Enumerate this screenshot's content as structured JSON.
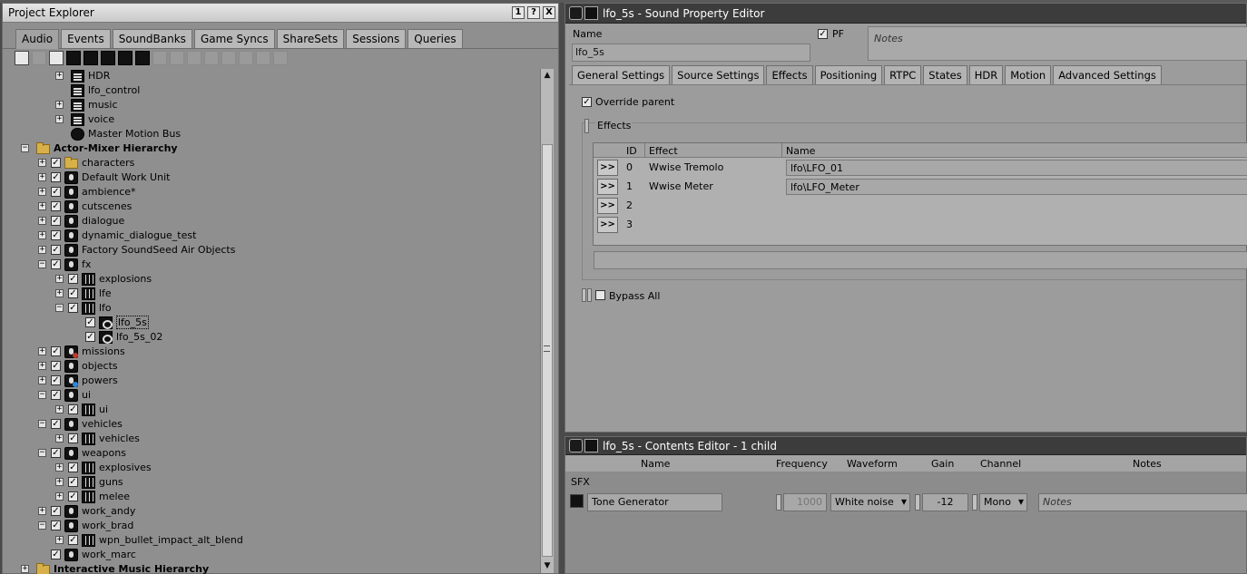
{
  "project_explorer": {
    "title": "Project Explorer",
    "title_buttons": [
      "1",
      "?",
      "X"
    ],
    "tabs": [
      "Audio",
      "Events",
      "SoundBanks",
      "Game Syncs",
      "ShareSets",
      "Sessions",
      "Queries"
    ],
    "active_tab": "Audio",
    "tree": [
      {
        "label": "HDR",
        "indent": 2,
        "icon": "bus",
        "exp": "+"
      },
      {
        "label": "lfo_control",
        "indent": 2,
        "icon": "bus",
        "exp": ""
      },
      {
        "label": "music",
        "indent": 2,
        "icon": "bus",
        "exp": "+"
      },
      {
        "label": "voice",
        "indent": 2,
        "icon": "bus",
        "exp": "+"
      },
      {
        "label": "Master Motion Bus",
        "indent": 2,
        "icon": "motion",
        "exp": ""
      },
      {
        "label": "Actor-Mixer Hierarchy",
        "indent": 0,
        "icon": "folder",
        "exp": "-",
        "bold": true,
        "check": false
      },
      {
        "label": "characters",
        "indent": 1,
        "icon": "folder",
        "exp": "+",
        "check": true
      },
      {
        "label": "Default Work Unit",
        "indent": 1,
        "icon": "wu",
        "exp": "+",
        "check": true
      },
      {
        "label": "ambience*",
        "indent": 1,
        "icon": "wu",
        "exp": "+",
        "check": true
      },
      {
        "label": "cutscenes",
        "indent": 1,
        "icon": "wu",
        "exp": "+",
        "check": true
      },
      {
        "label": "dialogue",
        "indent": 1,
        "icon": "wu",
        "exp": "+",
        "check": true
      },
      {
        "label": "dynamic_dialogue_test",
        "indent": 1,
        "icon": "wu",
        "exp": "+",
        "check": true
      },
      {
        "label": "Factory SoundSeed Air Objects",
        "indent": 1,
        "icon": "wu",
        "exp": "+",
        "check": true
      },
      {
        "label": "fx",
        "indent": 1,
        "icon": "wu",
        "exp": "-",
        "check": true
      },
      {
        "label": "explosions",
        "indent": 2,
        "icon": "mix",
        "exp": "+",
        "check": true
      },
      {
        "label": "lfe",
        "indent": 2,
        "icon": "mix",
        "exp": "+",
        "check": true
      },
      {
        "label": "lfo",
        "indent": 2,
        "icon": "mix",
        "exp": "-",
        "check": true
      },
      {
        "label": "lfo_5s",
        "indent": 3,
        "icon": "snd",
        "exp": "",
        "check": true,
        "selected": true
      },
      {
        "label": "lfo_5s_02",
        "indent": 3,
        "icon": "snd",
        "exp": "",
        "check": true
      },
      {
        "label": "missions",
        "indent": 1,
        "icon": "wu",
        "exp": "+",
        "check": true,
        "badge": "#c0392b"
      },
      {
        "label": "objects",
        "indent": 1,
        "icon": "wu",
        "exp": "+",
        "check": true
      },
      {
        "label": "powers",
        "indent": 1,
        "icon": "wu",
        "exp": "+",
        "check": true,
        "badge": "#2e86de"
      },
      {
        "label": "ui",
        "indent": 1,
        "icon": "wu",
        "exp": "-",
        "check": true
      },
      {
        "label": "ui",
        "indent": 2,
        "icon": "mix",
        "exp": "+",
        "check": true
      },
      {
        "label": "vehicles",
        "indent": 1,
        "icon": "wu",
        "exp": "-",
        "check": true
      },
      {
        "label": "vehicles",
        "indent": 2,
        "icon": "mix",
        "exp": "+",
        "check": true
      },
      {
        "label": "weapons",
        "indent": 1,
        "icon": "wu",
        "exp": "-",
        "check": true
      },
      {
        "label": "explosives",
        "indent": 2,
        "icon": "mix",
        "exp": "+",
        "check": true
      },
      {
        "label": "guns",
        "indent": 2,
        "icon": "mix",
        "exp": "+",
        "check": true
      },
      {
        "label": "melee",
        "indent": 2,
        "icon": "mix",
        "exp": "+",
        "check": true
      },
      {
        "label": "work_andy",
        "indent": 1,
        "icon": "wu",
        "exp": "+",
        "check": true
      },
      {
        "label": "work_brad",
        "indent": 1,
        "icon": "wu",
        "exp": "-",
        "check": true
      },
      {
        "label": "wpn_bullet_impact_alt_blend",
        "indent": 2,
        "icon": "blend",
        "exp": "+",
        "check": true
      },
      {
        "label": "work_marc",
        "indent": 1,
        "icon": "wu",
        "exp": "",
        "check": true
      },
      {
        "label": "Interactive Music Hierarchy",
        "indent": 0,
        "icon": "folder",
        "exp": "+",
        "bold": true,
        "check": false
      }
    ]
  },
  "property_editor": {
    "title": "lfo_5s - Sound Property Editor",
    "name_label": "Name",
    "name_value": "lfo_5s",
    "pf_label": "PF",
    "notes_placeholder": "Notes",
    "tabs": [
      "General Settings",
      "Source Settings",
      "Effects",
      "Positioning",
      "RTPC",
      "States",
      "HDR",
      "Motion",
      "Advanced Settings"
    ],
    "active_tab": "Effects",
    "override_parent_label": "Override parent",
    "effects_group_label": "Effects",
    "columns": {
      "id": "ID",
      "effect": "Effect",
      "name": "Name"
    },
    "effects": [
      {
        "button": ">>",
        "id": "0",
        "effect": "Wwise Tremolo",
        "name": "lfo\\LFO_01"
      },
      {
        "button": ">>",
        "id": "1",
        "effect": "Wwise Meter",
        "name": "lfo\\LFO_Meter"
      },
      {
        "button": ">>",
        "id": "2",
        "effect": "",
        "name": ""
      },
      {
        "button": ">>",
        "id": "3",
        "effect": "",
        "name": ""
      }
    ],
    "bypass_all_label": "Bypass All"
  },
  "contents_editor": {
    "title": "lfo_5s - Contents Editor - 1 child",
    "columns": {
      "name": "Name",
      "frequency": "Frequency",
      "waveform": "Waveform",
      "gain": "Gain",
      "channel": "Channel",
      "notes": "Notes"
    },
    "section": "SFX",
    "row": {
      "name": "Tone Generator",
      "frequency": "1000",
      "waveform": "White noise",
      "gain": "-12",
      "channel": "Mono",
      "notes_placeholder": "Notes"
    }
  },
  "colors": {
    "panel_bg": "#8f8f8f",
    "header_dark": "#3c3c3c",
    "folder": "#d8b04a"
  }
}
